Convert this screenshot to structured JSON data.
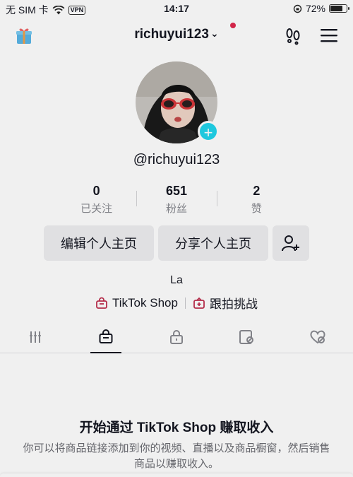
{
  "status_bar": {
    "carrier": "无 SIM 卡",
    "vpn": "VPN",
    "time": "14:17",
    "battery": "72%",
    "battery_level": 0.72
  },
  "header": {
    "username": "richuyui123",
    "icons": [
      "gift-icon",
      "chevron-down-icon",
      "footprint-icon",
      "menu-icon"
    ]
  },
  "profile": {
    "handle": "@richuyui123",
    "bio": "La"
  },
  "stats": [
    {
      "value": "0",
      "label": "已关注"
    },
    {
      "value": "651",
      "label": "粉丝"
    },
    {
      "value": "2",
      "label": "赞"
    }
  ],
  "buttons": {
    "edit": "编辑个人主页",
    "share": "分享个人主页"
  },
  "links": {
    "shop": "TikTok Shop",
    "challenge": "跟拍挑战"
  },
  "tabs": [
    "grid-icon",
    "shop-bag-icon",
    "lock-icon",
    "tagged-icon",
    "liked-icon"
  ],
  "empty_state": {
    "title": "开始通过 TikTok Shop 赚取收入",
    "description": "你可以将商品链接添加到你的视频、直播以及商品橱窗，然后销售商品以赚取收入。"
  },
  "colors": {
    "accent": "#20d5ec",
    "notification": "#e0284e",
    "link_icon": "#c0304f"
  }
}
